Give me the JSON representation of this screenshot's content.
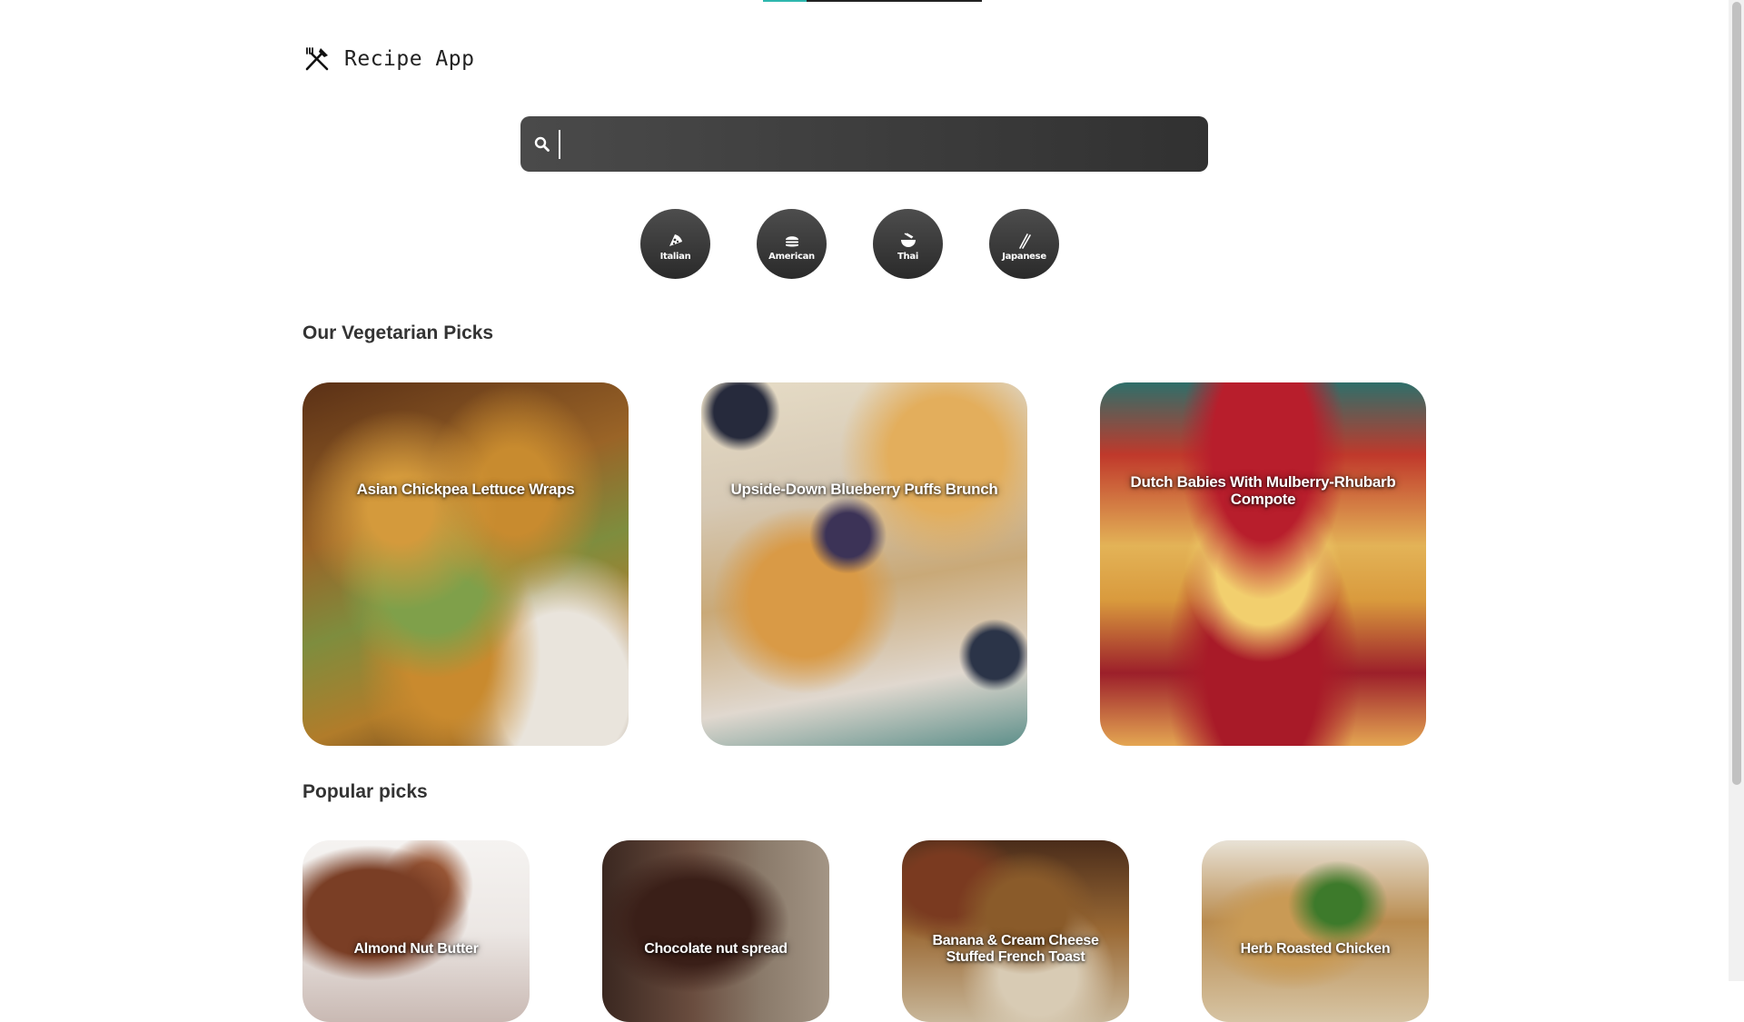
{
  "app": {
    "title": "Recipe App",
    "logo_icon": "fork-knife-icon"
  },
  "loading_progress": 0.2,
  "search": {
    "value": "",
    "placeholder": "",
    "icon": "search-icon"
  },
  "categories": [
    {
      "label": "Italian",
      "icon": "pizza-icon"
    },
    {
      "label": "American",
      "icon": "burger-icon"
    },
    {
      "label": "Thai",
      "icon": "noodle-bowl-icon"
    },
    {
      "label": "Japanese",
      "icon": "chopsticks-icon"
    }
  ],
  "sections": {
    "vegetarian": {
      "title": "Our Vegetarian Picks",
      "items": [
        {
          "label": "Asian Chickpea Lettuce Wraps"
        },
        {
          "label": "Upside-Down Blueberry Puffs Brunch"
        },
        {
          "label": "Dutch Babies With Mulberry-Rhubarb Compote"
        }
      ]
    },
    "popular": {
      "title": "Popular picks",
      "items": [
        {
          "label": "Almond Nut Butter"
        },
        {
          "label": "Chocolate nut spread"
        },
        {
          "label": "Banana & Cream Cheese Stuffed French Toast"
        },
        {
          "label": "Herb Roasted Chicken"
        }
      ]
    }
  },
  "colors": {
    "accent": "#2fb7ae",
    "search_bg": "#3a3a3a",
    "category_bg": "#333333"
  }
}
